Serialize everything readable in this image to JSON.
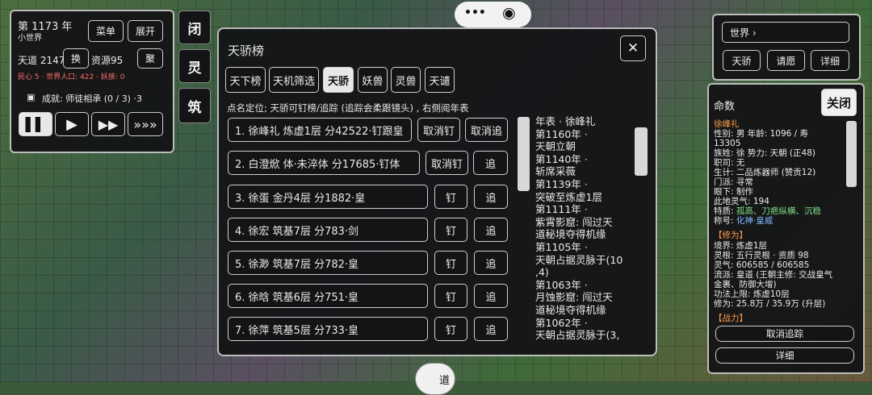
{
  "top_left": {
    "year": "第 1173 年",
    "world": "小世界",
    "menu_btn": "菜单",
    "expand_btn": "展开",
    "tiandao": "天道 2147",
    "swap_btn": "换",
    "resources": "资源95",
    "gather_btn": "聚",
    "status_line": "民心 5 · 世界人口: 422 · 妖族: 0",
    "achievement": "成就: 师徒相承 (0 / 3) ·3",
    "speed_buttons": [
      "▌▌",
      "▶",
      "▶▶",
      "»»»"
    ]
  },
  "side_tabs": [
    "闭",
    "灵",
    "筑"
  ],
  "top_center": {
    "more": "•••",
    "record": "◉"
  },
  "bottom_center": {
    "label": "道"
  },
  "ranking": {
    "title": "天骄榜",
    "close": "✕",
    "tabs": [
      "天下榜",
      "天机筛选",
      "天骄",
      "妖兽",
      "灵兽",
      "天谴"
    ],
    "active_tab": 2,
    "hint": "点名定位; 天骄可钉榜/追踪 (追踪会柔跟镜头) , 右侧阅年表",
    "rows": [
      {
        "label": "1. 徐峰礼  炼虚1层  分42522·钉跟皇",
        "b1": "取消钉",
        "b2": "取消追"
      },
      {
        "label": "2. 白澄焮  体·未淬体  分17685·钉体",
        "b1": "取消钉",
        "b2": "追"
      },
      {
        "label": "3. 徐蛋  金丹4层  分1882·皇",
        "b1": "钉",
        "b2": "追"
      },
      {
        "label": "4. 徐宏  筑基7层  分783·剑",
        "b1": "钉",
        "b2": "追"
      },
      {
        "label": "5. 徐渺  筑基7层  分782·皇",
        "b1": "钉",
        "b2": "追"
      },
      {
        "label": "6. 徐晗  筑基6层  分751·皇",
        "b1": "钉",
        "b2": "追"
      },
      {
        "label": "7. 徐萍  筑基5层  分733·皇",
        "b1": "钉",
        "b2": "追"
      }
    ],
    "chronicle": [
      "年表 · 徐峰礼",
      "第1160年 ·",
      "天朝立朝",
      "第1140年 ·",
      "斩席采薇",
      "第1139年 ·",
      "突破至炼虚1层",
      "第1111年 ·",
      "紫霄影窟: 闯过天",
      "道秘境夺得机缘",
      "第1105年 ·",
      "天朝占据灵脉于(10",
      ",4)",
      "第1063年 ·",
      "月蚀影窟: 闯过天",
      "道秘境夺得机缘",
      "第1062年 ·",
      "天朝占据灵脉于(3,"
    ]
  },
  "top_right": {
    "world_label": "世界 ›",
    "buttons": [
      "天骄",
      "请愿",
      "详细"
    ]
  },
  "mingshu": {
    "title": "命数",
    "close": "关闭",
    "name": "徐峰礼",
    "lines": [
      "性别: 男   年龄: 1096 / 寿",
      "13305",
      "族姓: 徐   势力: 天朝 (正48)",
      "职司: 无",
      "生计: 二品炼器师 (赞贡12)",
      "门派: 寻常",
      "眼下: 制作",
      "此地灵气: 194"
    ],
    "traits_label": "特质: ",
    "traits": "孤高、刀疤纵横、沉稳",
    "title_label": "称号: ",
    "title_value": "化神·皇威",
    "cultivation_header": "【修为】",
    "cultivation": [
      "境界: 炼虚1层",
      "灵根: 五行灵根 · 资质 98",
      "灵气: 606585 / 606585",
      "流派: 皇道 (王朝主修: 交战皇气",
      "金裹、防御大增)",
      "功法上限: 炼虚10层",
      "修为: 25.8万 / 35.9万 (升层)"
    ],
    "battle_header": "【战力】",
    "stop_tracking": "取消追踪",
    "detail": "详细"
  },
  "colors": {
    "accent_red": "#ff6b6b",
    "trait_green": "#7fe08a",
    "title_blue": "#7fb6ff",
    "header_orange": "#ff9a4a"
  }
}
